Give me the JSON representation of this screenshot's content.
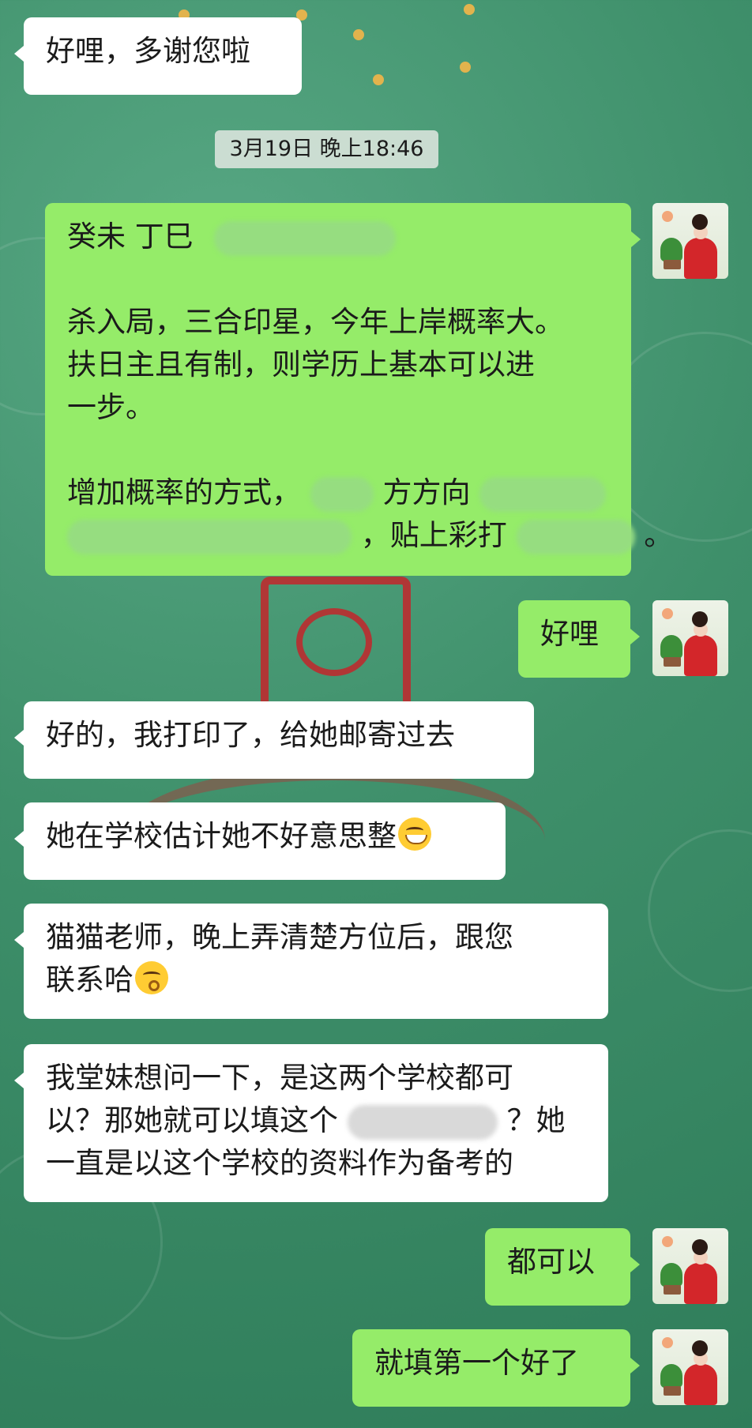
{
  "messages": {
    "m1": {
      "text": "好哩，多谢您啦"
    },
    "timestamp": "3月19日  晚上18:46",
    "m2": {
      "line1": "癸未  丁巳",
      "line2": "杀入局，三合印星，今年上岸概率大。",
      "line3": "扶日主且有制，则学历上基本可以进",
      "line4": "一步。",
      "line5a": "增加概率的方式，",
      "line5b": "方方向",
      "line6b": "，贴上彩打",
      "line6c": "。"
    },
    "m3": {
      "text": "好哩"
    },
    "m4": {
      "text": "好的，我打印了，给她邮寄过去"
    },
    "m5": {
      "text": "她在学校估计她不好意思整"
    },
    "m6": {
      "line1": "猫猫老师，晚上弄清楚方位后，跟您",
      "line2": "联系哈"
    },
    "m7": {
      "line1": "我堂妹想问一下，是这两个学校都可",
      "line2a": "以？那她就可以填这个",
      "line2b": "？她",
      "line3": "一直是以这个学校的资料作为备考的"
    },
    "m8": {
      "text": "都可以"
    },
    "m9": {
      "text": "就填第一个好了"
    }
  },
  "emojis": {
    "grin": "grinning-face-emoji",
    "kiss": "kissing-face-emoji"
  },
  "colors": {
    "incoming": "#ffffff",
    "outgoing": "#95ec69",
    "background": "#3e8f6a"
  }
}
